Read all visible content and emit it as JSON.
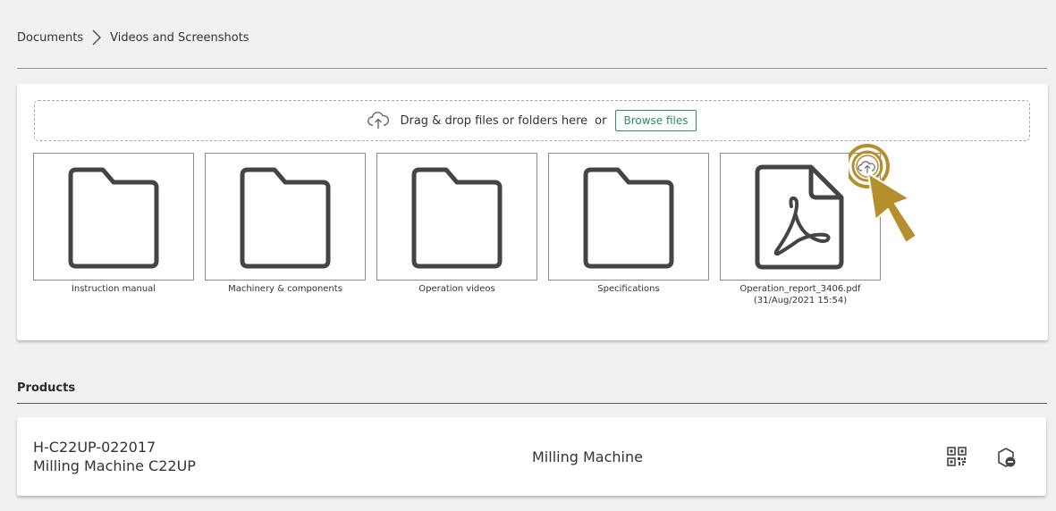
{
  "breadcrumb": {
    "root": "Documents",
    "current": "Videos and Screenshots",
    "separator_icon": "chevron-right-icon"
  },
  "dropzone": {
    "icon": "cloud-upload-icon",
    "text": "Drag & drop files or folders here",
    "or": "or",
    "browse_label": "Browse files"
  },
  "tiles": [
    {
      "type": "folder",
      "label": "Instruction manual",
      "sublabel": ""
    },
    {
      "type": "folder",
      "label": "Machinery & components",
      "sublabel": ""
    },
    {
      "type": "folder",
      "label": "Operation videos",
      "sublabel": ""
    },
    {
      "type": "folder",
      "label": "Specifications",
      "sublabel": ""
    },
    {
      "type": "pdf",
      "label": "Operation_report_3406.pdf",
      "sublabel": "(31/Aug/2021 15:54)"
    }
  ],
  "products": {
    "title": "Products",
    "items": [
      {
        "id": "H-C22UP-022017",
        "name": "Milling Machine C22UP",
        "type": "Milling Machine",
        "actions": [
          "qr-code-icon",
          "remove-icon"
        ]
      }
    ]
  },
  "colors": {
    "accent": "#2e8b6f",
    "cursor": "#b58f2e",
    "background": "#f1f1f1"
  }
}
